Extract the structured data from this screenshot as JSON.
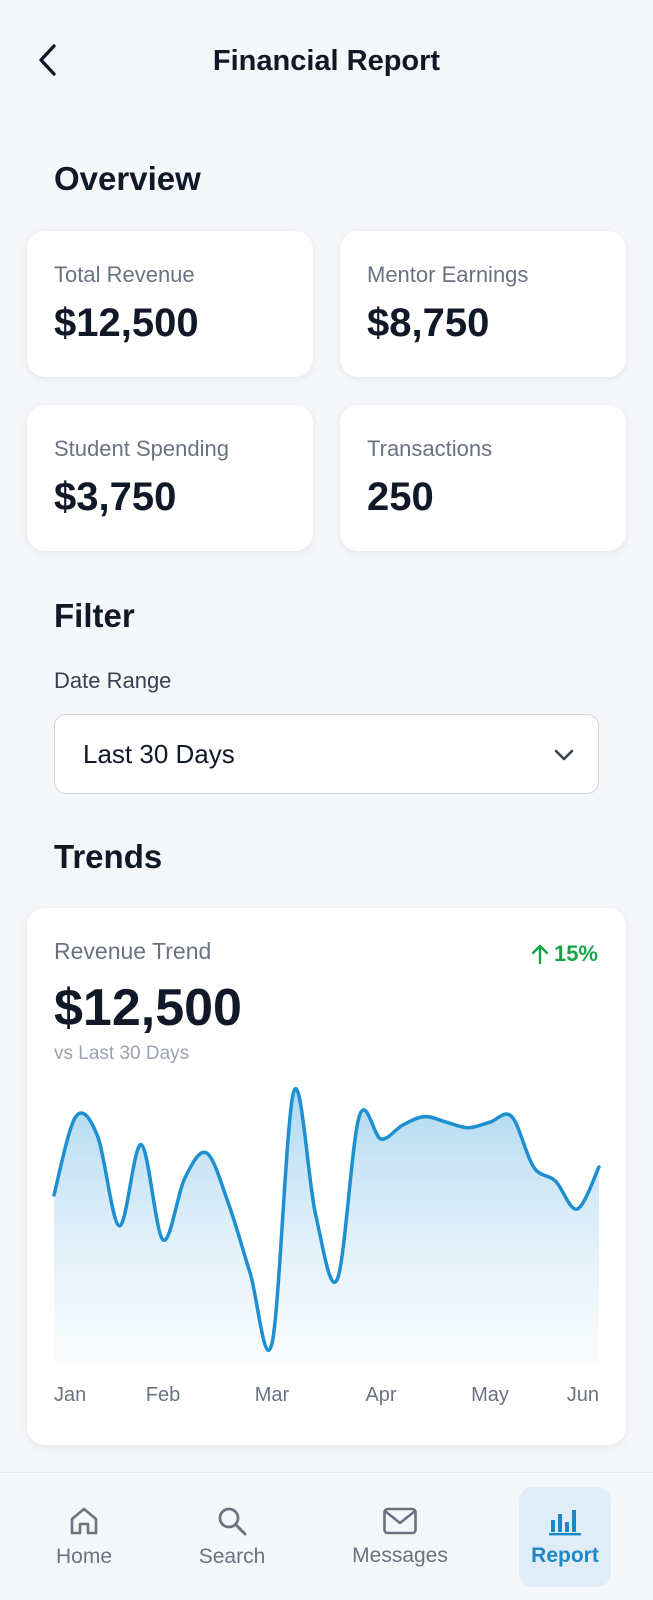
{
  "header": {
    "title": "Financial Report"
  },
  "overview": {
    "title": "Overview",
    "cards": [
      {
        "label": "Total Revenue",
        "value": "$12,500"
      },
      {
        "label": "Mentor Earnings",
        "value": "$8,750"
      },
      {
        "label": "Student Spending",
        "value": "$3,750"
      },
      {
        "label": "Transactions",
        "value": "250"
      }
    ]
  },
  "filter": {
    "title": "Filter",
    "date_range_label": "Date Range",
    "date_range_value": "Last 30 Days"
  },
  "trends": {
    "title": "Trends",
    "card_label": "Revenue Trend",
    "value": "$12,500",
    "change": "15%",
    "comparison": "vs Last 30 Days"
  },
  "chart_data": {
    "type": "area",
    "categories": [
      "Jan",
      "Feb",
      "Mar",
      "Apr",
      "May",
      "Jun"
    ],
    "x": [
      0,
      0.2,
      0.4,
      0.6,
      0.8,
      1.0,
      1.2,
      1.4,
      1.6,
      1.8,
      2.0,
      2.2,
      2.4,
      2.6,
      2.8,
      3.0,
      3.2,
      3.4,
      3.6,
      3.8,
      4.0,
      4.2,
      4.4,
      4.6,
      4.8,
      5.0
    ],
    "values": [
      20,
      48,
      41,
      9,
      38,
      4,
      26,
      35,
      17,
      -8,
      -33,
      57,
      13,
      -10,
      48,
      40,
      45,
      48,
      46,
      44,
      46,
      48,
      30,
      25,
      15,
      30
    ],
    "ylim": [
      -40,
      60
    ],
    "grid": false,
    "colors": {
      "line": "#1e8fd0",
      "fill_top": "#a9d5f0",
      "fill_bottom": "#f0f7fc"
    }
  },
  "nav": {
    "items": [
      {
        "label": "Home",
        "icon": "home-icon"
      },
      {
        "label": "Search",
        "icon": "search-icon"
      },
      {
        "label": "Messages",
        "icon": "mail-icon"
      },
      {
        "label": "Report",
        "icon": "bar-chart-icon"
      }
    ],
    "active_index": 3
  },
  "colors": {
    "accent": "#1e88c7",
    "positive": "#16a34a",
    "background": "#f5f7fa"
  }
}
